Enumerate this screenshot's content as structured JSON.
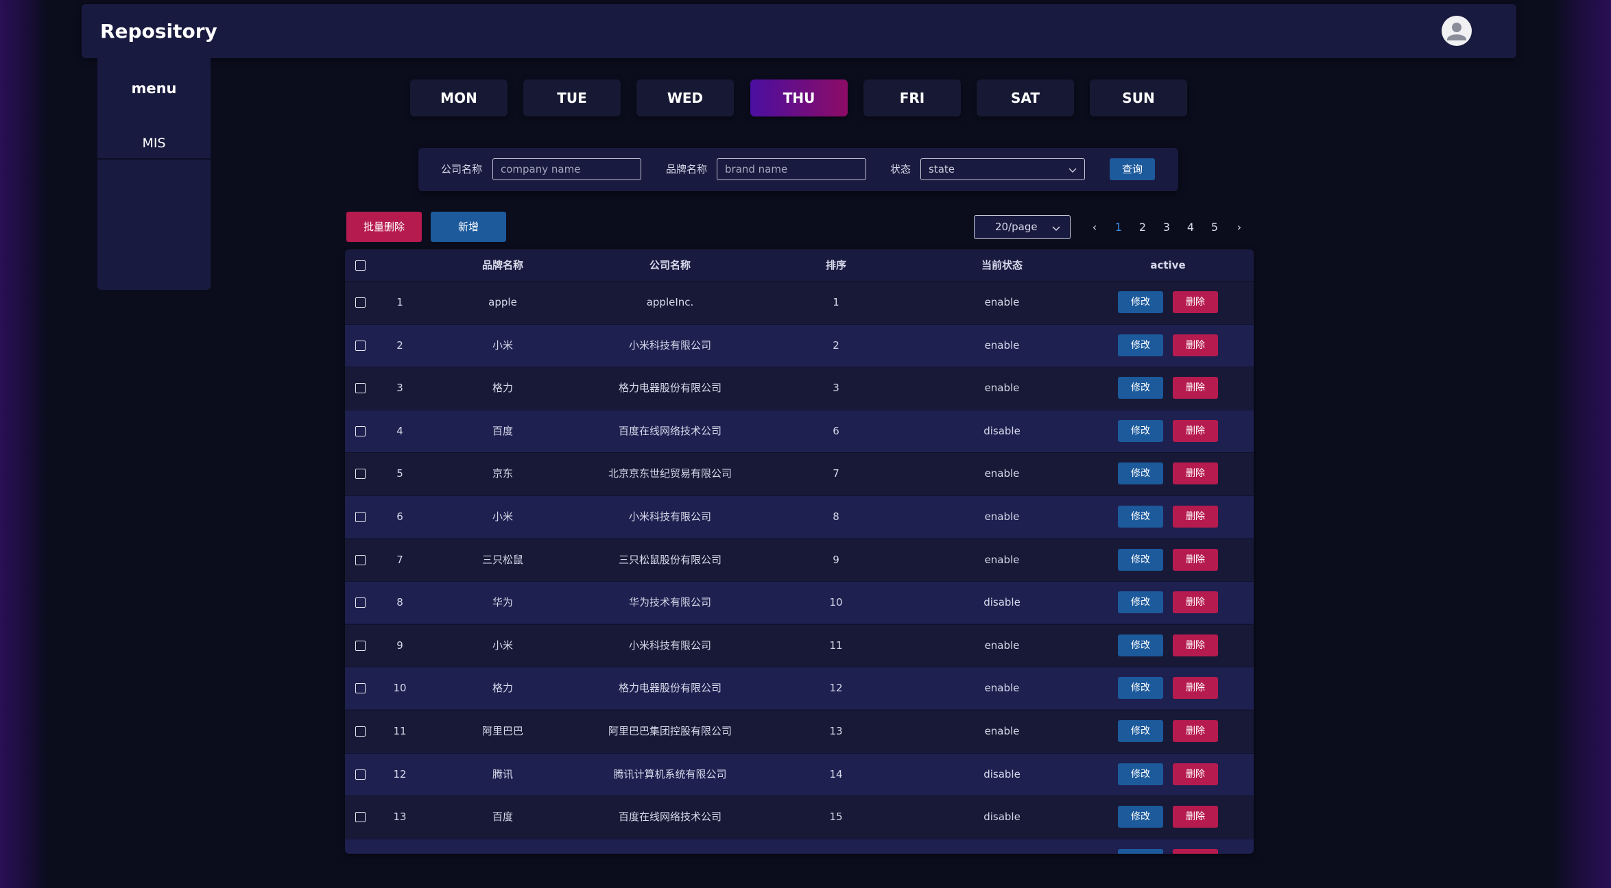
{
  "header": {
    "title": "Repository",
    "avatar_icon": "user-avatar-icon"
  },
  "sidebar": {
    "title": "menu",
    "items": [
      {
        "label": "MIS"
      }
    ]
  },
  "days": [
    {
      "label": "MON",
      "active": false
    },
    {
      "label": "TUE",
      "active": false
    },
    {
      "label": "WED",
      "active": false
    },
    {
      "label": "THU",
      "active": true
    },
    {
      "label": "FRI",
      "active": false
    },
    {
      "label": "SAT",
      "active": false
    },
    {
      "label": "SUN",
      "active": false
    }
  ],
  "filter": {
    "company_label": "公司名称",
    "company_placeholder": "company name",
    "brand_label": "品牌名称",
    "brand_placeholder": "brand name",
    "state_label": "状态",
    "state_placeholder": "state",
    "query_button": "查询"
  },
  "actions": {
    "batch_delete": "批量删除",
    "add": "新增"
  },
  "pagination": {
    "page_size": "20/page",
    "pages": [
      "1",
      "2",
      "3",
      "4",
      "5"
    ],
    "current": "1",
    "prev_icon": "chevron-left-icon",
    "next_icon": "chevron-right-icon"
  },
  "table": {
    "headers": [
      "品牌名称",
      "公司名称",
      "排序",
      "当前状态",
      "active"
    ],
    "edit_label": "修改",
    "delete_label": "删除",
    "rows": [
      {
        "index": "1",
        "brand": "apple",
        "company": "appleInc.",
        "order": "1",
        "status": "enable"
      },
      {
        "index": "2",
        "brand": "小米",
        "company": "小米科技有限公司",
        "order": "2",
        "status": "enable"
      },
      {
        "index": "3",
        "brand": "格力",
        "company": "格力电器股份有限公司",
        "order": "3",
        "status": "enable"
      },
      {
        "index": "4",
        "brand": "百度",
        "company": "百度在线网络技术公司",
        "order": "6",
        "status": "disable"
      },
      {
        "index": "5",
        "brand": "京东",
        "company": "北京京东世纪贸易有限公司",
        "order": "7",
        "status": "enable"
      },
      {
        "index": "6",
        "brand": "小米",
        "company": "小米科技有限公司",
        "order": "8",
        "status": "enable"
      },
      {
        "index": "7",
        "brand": "三只松鼠",
        "company": "三只松鼠股份有限公司",
        "order": "9",
        "status": "enable"
      },
      {
        "index": "8",
        "brand": "华为",
        "company": "华为技术有限公司",
        "order": "10",
        "status": "disable"
      },
      {
        "index": "9",
        "brand": "小米",
        "company": "小米科技有限公司",
        "order": "11",
        "status": "enable"
      },
      {
        "index": "10",
        "brand": "格力",
        "company": "格力电器股份有限公司",
        "order": "12",
        "status": "enable"
      },
      {
        "index": "11",
        "brand": "阿里巴巴",
        "company": "阿里巴巴集团控股有限公司",
        "order": "13",
        "status": "enable"
      },
      {
        "index": "12",
        "brand": "腾讯",
        "company": "腾讯计算机系统有限公司",
        "order": "14",
        "status": "disable"
      },
      {
        "index": "13",
        "brand": "百度",
        "company": "百度在线网络技术公司",
        "order": "15",
        "status": "disable"
      }
    ]
  }
}
